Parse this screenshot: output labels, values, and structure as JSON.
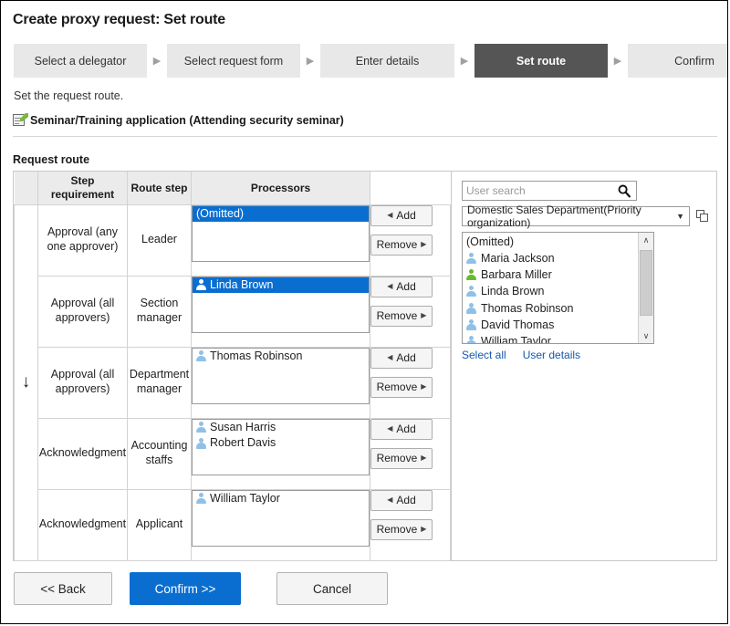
{
  "page": {
    "title": "Create proxy request: Set route",
    "description": "Set the request route.",
    "form_name": "Seminar/Training application (Attending security seminar)",
    "section_title": "Request route",
    "flow_arrow": "↓"
  },
  "steps": [
    {
      "label": "Select a delegator",
      "active": false
    },
    {
      "label": "Select request form",
      "active": false
    },
    {
      "label": "Enter details",
      "active": false
    },
    {
      "label": "Set route",
      "active": true
    },
    {
      "label": "Confirm",
      "active": false
    }
  ],
  "step_separator": "▶",
  "table": {
    "headers": {
      "arrow": "",
      "step_requirement": "Step requirement",
      "route_step": "Route step",
      "processors": "Processors",
      "buttons": ""
    },
    "add_label": "Add",
    "remove_label": "Remove",
    "add_arrow": "◀",
    "remove_arrow": "▶",
    "rows": [
      {
        "step_requirement": "Approval (any one approver)",
        "route_step": "Leader",
        "processors": [
          {
            "name": "(Omitted)",
            "selected": true,
            "icon": "none"
          }
        ]
      },
      {
        "step_requirement": "Approval (all approvers)",
        "route_step": "Section manager",
        "processors": [
          {
            "name": "Linda Brown",
            "selected": true,
            "icon": "person-icon-white"
          }
        ]
      },
      {
        "step_requirement": "Approval (all approvers)",
        "route_step": "Department manager",
        "processors": [
          {
            "name": "Thomas Robinson",
            "selected": false,
            "icon": "person-icon-blue"
          }
        ]
      },
      {
        "step_requirement": "Acknowledgment",
        "route_step": "Accounting staffs",
        "processors": [
          {
            "name": "Susan Harris",
            "selected": false,
            "icon": "person-icon-blue"
          },
          {
            "name": "Robert Davis",
            "selected": false,
            "icon": "person-icon-blue"
          }
        ]
      },
      {
        "step_requirement": "Acknowledgment",
        "route_step": "Applicant",
        "processors": [
          {
            "name": "William Taylor",
            "selected": false,
            "icon": "person-icon-blue"
          }
        ]
      }
    ]
  },
  "user_pane": {
    "search_placeholder": "User search",
    "search_value": "",
    "organization_selected": "Domestic Sales Department(Priority organization)",
    "organization_caret": "▼",
    "users": [
      {
        "name": "(Omitted)",
        "icon": "none"
      },
      {
        "name": "Maria Jackson",
        "icon": "person-icon-blue"
      },
      {
        "name": "Barbara Miller",
        "icon": "person-icon-green"
      },
      {
        "name": "Linda Brown",
        "icon": "person-icon-blue"
      },
      {
        "name": "Thomas Robinson",
        "icon": "person-icon-blue"
      },
      {
        "name": "David Thomas",
        "icon": "person-icon-blue"
      },
      {
        "name": "William Taylor",
        "icon": "person-icon-blue"
      }
    ],
    "scroll_up": "∧",
    "scroll_down": "∨",
    "select_all_label": "Select all",
    "user_details_label": "User details"
  },
  "footer": {
    "back_label": "<< Back",
    "confirm_label": "Confirm >>",
    "cancel_label": "Cancel"
  },
  "colors": {
    "selection_blue": "#0a6ed1",
    "active_step_gray": "#555555",
    "step_gray": "#e8e8e8",
    "link_blue": "#1558b0",
    "online_green": "#65bb2a",
    "person_blue": "#8fc1e8"
  }
}
